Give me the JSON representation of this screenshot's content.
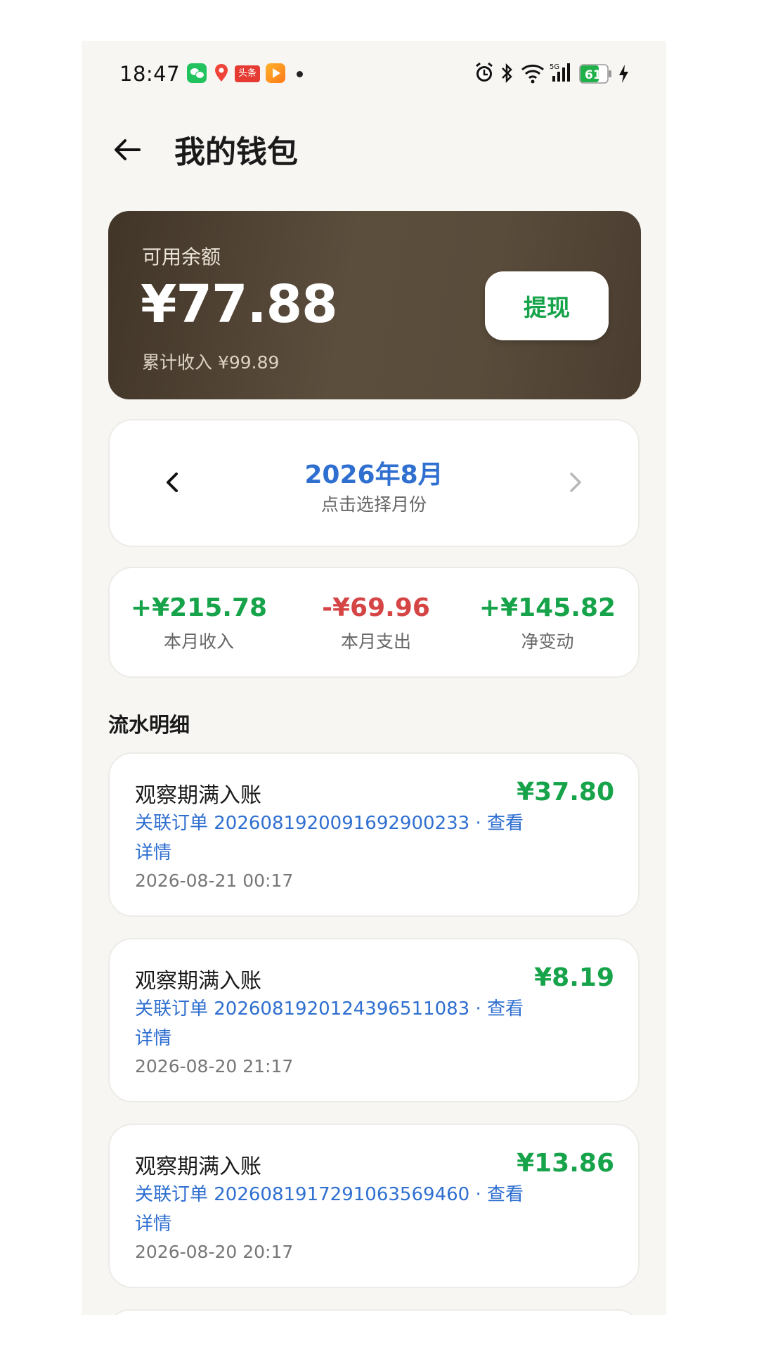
{
  "status_bar": {
    "time": "18:47",
    "toutiao_label": "头条",
    "network": "5G",
    "battery": "61"
  },
  "header": {
    "title": "我的钱包"
  },
  "balance_card": {
    "label": "可用余额",
    "amount": "¥77.88",
    "cumulative": "累计收入 ¥99.89",
    "withdraw_label": "提现"
  },
  "month_selector": {
    "month": "2026年8月",
    "hint": "点击选择月份"
  },
  "stats": {
    "income_value": "+¥215.78",
    "income_label": "本月收入",
    "expense_value": "-¥69.96",
    "expense_label": "本月支出",
    "net_value": "+¥145.82",
    "net_label": "净变动"
  },
  "section_title": "流水明细",
  "transactions": [
    {
      "title": "观察期满入账",
      "amount": "¥37.80",
      "link": "关联订单 20260819200916929002­33 · 查看详情",
      "time": "2026-08-21 00:17"
    },
    {
      "title": "观察期满入账",
      "amount": "¥8.19",
      "link": "关联订单 20260819201243965110­83 · 查看详情",
      "time": "2026-08-20 21:17"
    },
    {
      "title": "观察期满入账",
      "amount": "¥13.86",
      "link": "关联订单 20260819172910635694­60 · 查看详情",
      "time": "2026-08-20 20:17"
    }
  ],
  "colors": {
    "accent_blue": "#2f6fd0",
    "income_green": "#16a34a",
    "expense_red": "#d64545",
    "card_brown": "#4f4233"
  }
}
